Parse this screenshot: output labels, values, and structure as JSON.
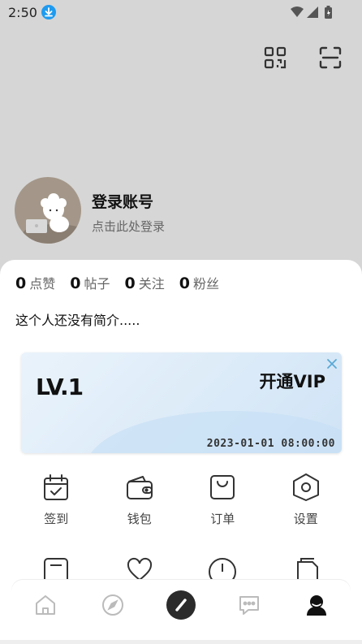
{
  "status": {
    "time": "2:50"
  },
  "profile": {
    "title": "登录账号",
    "subtitle": "点击此处登录"
  },
  "stats": [
    {
      "num": "0",
      "label": "点赞"
    },
    {
      "num": "0",
      "label": "帖子"
    },
    {
      "num": "0",
      "label": "关注"
    },
    {
      "num": "0",
      "label": "粉丝"
    }
  ],
  "bio": "这个人还没有简介.....",
  "vip": {
    "level": "LV.1",
    "cta": "开通VIP",
    "date": "2023-01-01 08:00:00"
  },
  "menu": [
    {
      "label": "签到",
      "icon": "calendar-check-icon"
    },
    {
      "label": "钱包",
      "icon": "wallet-icon"
    },
    {
      "label": "订单",
      "icon": "shopping-bag-icon"
    },
    {
      "label": "设置",
      "icon": "settings-hexagon-icon"
    }
  ],
  "colors": {
    "accent": "#1e9bf0",
    "header_bg": "#d6d6d6",
    "vip_bg": "#dcebf8"
  },
  "bottom_nav": [
    "home-icon",
    "compass-icon",
    "pen-icon",
    "chat-icon",
    "profile-icon"
  ]
}
